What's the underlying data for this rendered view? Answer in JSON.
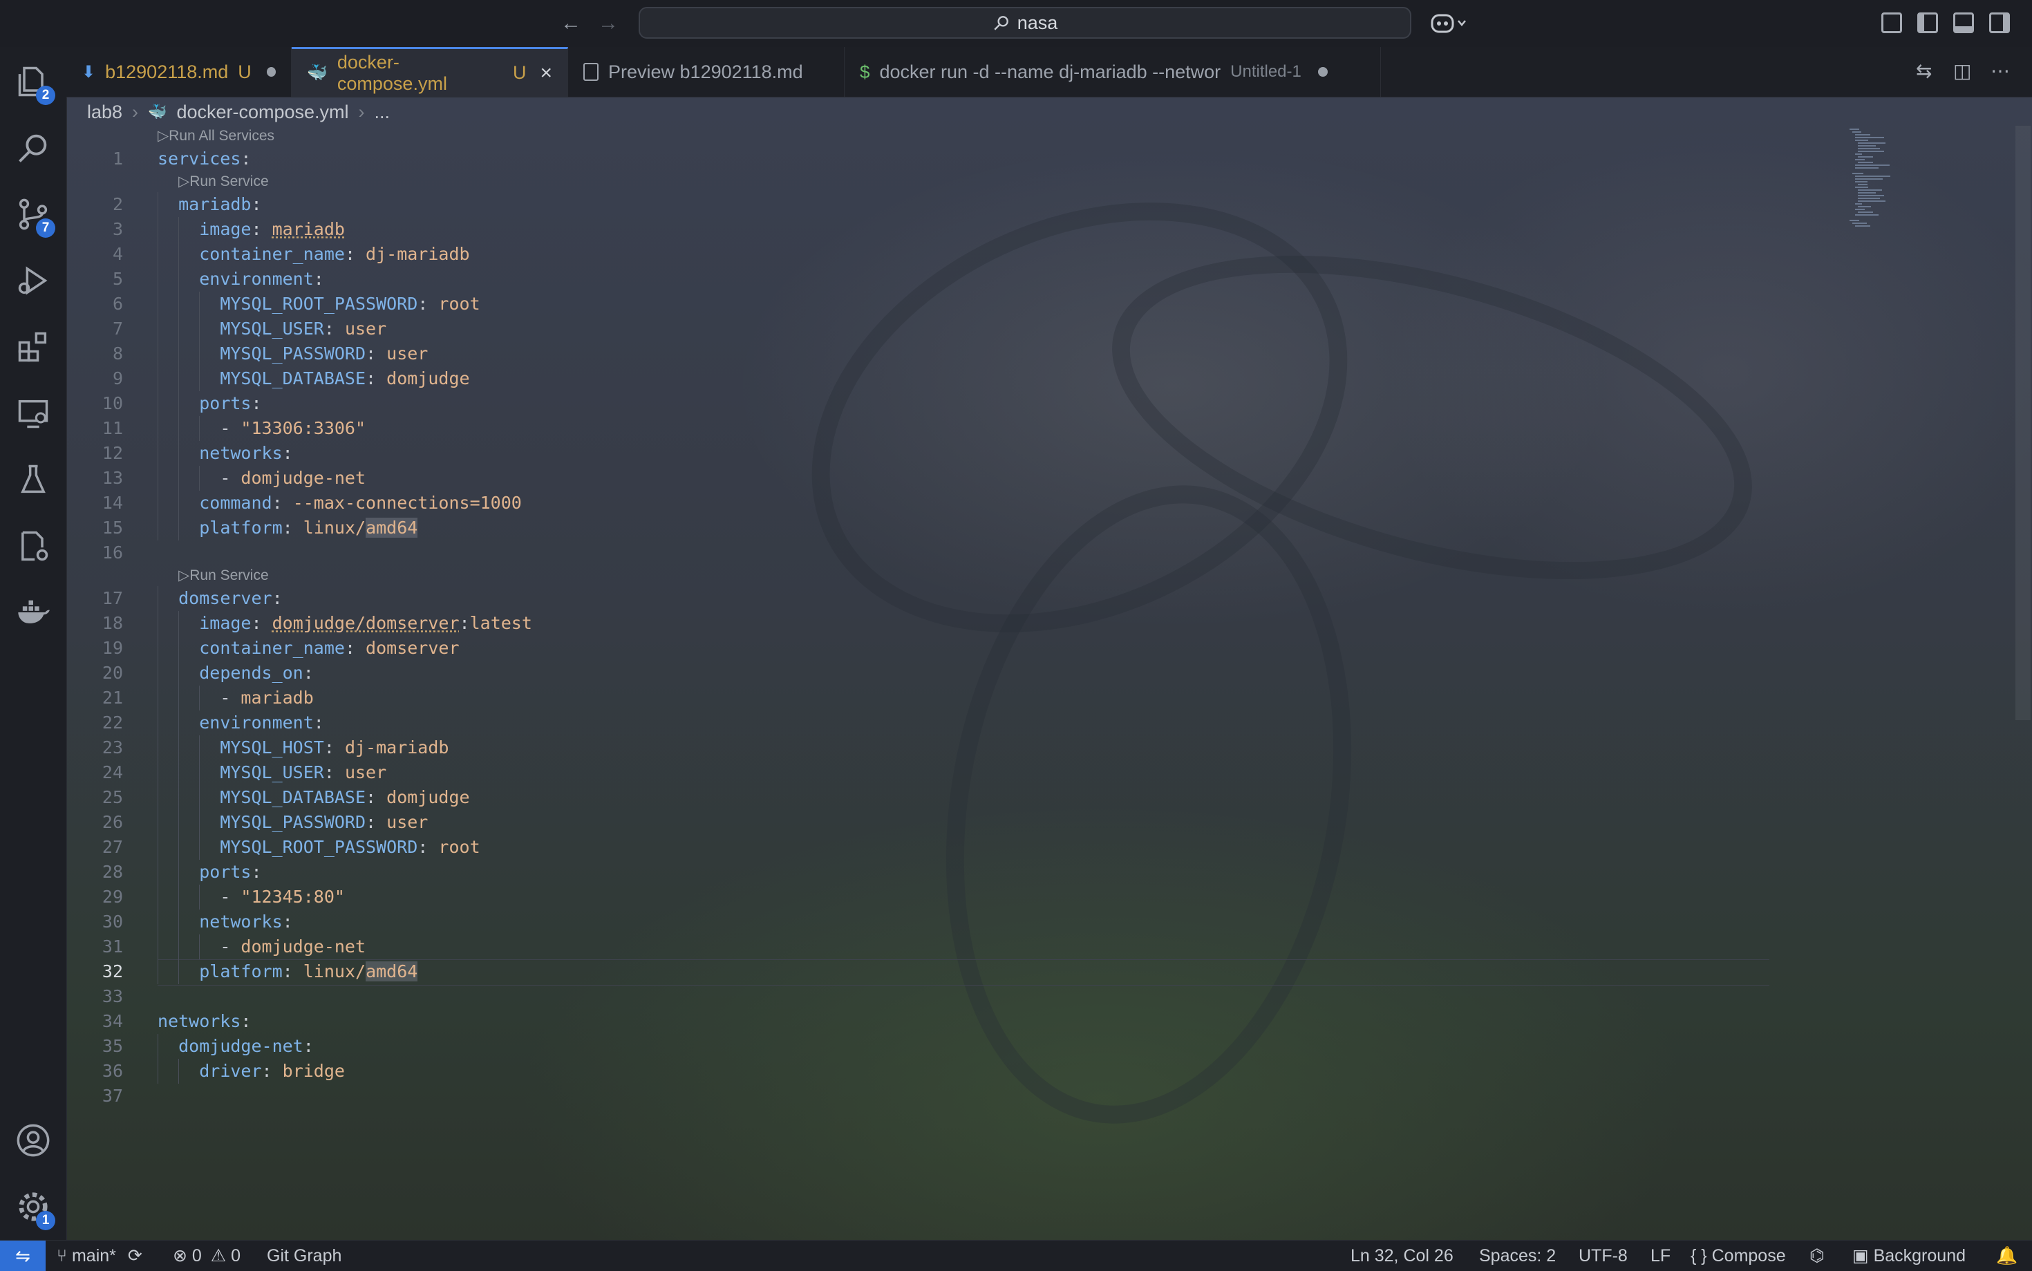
{
  "titlebar": {
    "search_text": "nasa",
    "back_icon": "arrow-left-icon",
    "forward_icon": "arrow-right-icon",
    "search_icon": "search-icon",
    "copilot_icon": "copilot-icon"
  },
  "activity_bar": {
    "items": [
      {
        "name": "explorer",
        "icon": "files-icon",
        "badge": "2"
      },
      {
        "name": "search",
        "icon": "search-icon",
        "badge": ""
      },
      {
        "name": "source-control",
        "icon": "source-control-icon",
        "badge": "7"
      },
      {
        "name": "run-debug",
        "icon": "run-debug-icon",
        "badge": ""
      },
      {
        "name": "extensions",
        "icon": "extensions-icon",
        "badge": ""
      },
      {
        "name": "remote-explorer",
        "icon": "remote-explorer-icon",
        "badge": ""
      },
      {
        "name": "testing",
        "icon": "flask-icon",
        "badge": ""
      },
      {
        "name": "container-tools",
        "icon": "container-settings-icon",
        "badge": ""
      },
      {
        "name": "docker",
        "icon": "docker-icon",
        "badge": ""
      }
    ],
    "accounts_icon": "account-icon",
    "settings_icon": "gear-icon",
    "settings_badge": "1"
  },
  "tabs": [
    {
      "label": "b12902118.md",
      "status": "U",
      "dirty": true,
      "icon": "markdown-icon",
      "active": false
    },
    {
      "label": "docker-compose.yml",
      "status": "U",
      "dirty": false,
      "icon": "docker-compose-icon",
      "active": true
    },
    {
      "label": "Preview b12902118.md",
      "status": "",
      "dirty": false,
      "icon": "preview-icon",
      "active": false
    },
    {
      "label": "docker run -d --name dj-mariadb --networ",
      "status": "Untitled-1",
      "dirty": true,
      "icon": "terminal-dollar-icon",
      "active": false
    }
  ],
  "breadcrumbs": [
    "lab8",
    "docker-compose.yml",
    "..."
  ],
  "codelens": {
    "run_all": "Run All Services",
    "run_service": "Run Service"
  },
  "code": {
    "current_line": 32,
    "lines": [
      "services:",
      "  mariadb:",
      "    image: mariadb",
      "    container_name: dj-mariadb",
      "    environment:",
      "      MYSQL_ROOT_PASSWORD: root",
      "      MYSQL_USER: user",
      "      MYSQL_PASSWORD: user",
      "      MYSQL_DATABASE: domjudge",
      "    ports:",
      "      - \"13306:3306\"",
      "    networks:",
      "      - domjudge-net",
      "    command: --max-connections=1000",
      "    platform: linux/amd64",
      "",
      "  domserver:",
      "    image: domjudge/domserver:latest",
      "    container_name: domserver",
      "    depends_on:",
      "      - mariadb",
      "    environment:",
      "      MYSQL_HOST: dj-mariadb",
      "      MYSQL_USER: user",
      "      MYSQL_DATABASE: domjudge",
      "      MYSQL_PASSWORD: user",
      "      MYSQL_ROOT_PASSWORD: root",
      "    ports:",
      "      - \"12345:80\"",
      "    networks:",
      "      - domjudge-net",
      "    platform: linux/amd64",
      "",
      "networks:",
      "  domjudge-net:",
      "    driver: bridge",
      ""
    ]
  },
  "statusbar": {
    "branch": "main*",
    "errors": "0",
    "warnings": "0",
    "git_graph": "Git Graph",
    "position": "Ln 32, Col 26",
    "spaces": "Spaces: 2",
    "encoding": "UTF-8",
    "eol": "LF",
    "language": "Compose",
    "background": "Background"
  },
  "colors": {
    "accent": "#2f6fd6",
    "key": "#7fb3e8",
    "value": "#e0b48e"
  }
}
